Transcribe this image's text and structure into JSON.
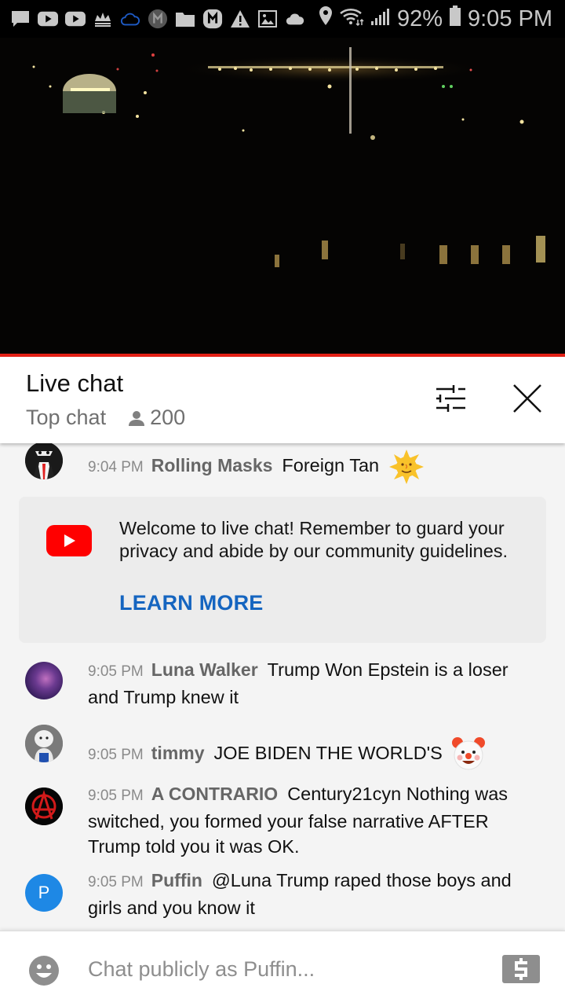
{
  "status_bar": {
    "notification_icons": [
      "message-icon",
      "youtube-icon",
      "youtube-icon",
      "crown-icon",
      "cloud-outline-icon",
      "m-app-icon",
      "folder-icon",
      "m-app-icon",
      "warning-icon",
      "image-icon",
      "cloud-icon"
    ],
    "battery": "92%",
    "time": "9:05 PM",
    "accent_cloud_color": "#1e5bc6"
  },
  "video": {
    "progress_color": "#e52117"
  },
  "header": {
    "title": "Live chat",
    "mode": "Top chat",
    "viewer_count": "200"
  },
  "messages": [
    {
      "time": "9:04 PM",
      "author": "Rolling Masks",
      "text": "Foreign Tan",
      "emoji": "🌞",
      "avatar": "mask"
    },
    {
      "time": "9:05 PM",
      "author": "Luna Walker",
      "text": "Trump Won Epstein is a loser and Trump knew it",
      "avatar": "purple"
    },
    {
      "time": "9:05 PM",
      "author": "timmy",
      "text": "JOE BIDEN THE WORLD'S",
      "emoji": "🤡",
      "avatar": "mascot"
    },
    {
      "time": "9:05 PM",
      "author": "A CONTRARIO",
      "text": "Century21cyn Nothing was switched, you formed your false narrative AFTER Trump told you it was OK.",
      "avatar": "anarchy"
    },
    {
      "time": "9:05 PM",
      "author": "Puffin",
      "text": "@Luna Trump raped those boys and girls and you know it",
      "avatar": "P",
      "avatar_color": "#1e88e5"
    }
  ],
  "welcome": {
    "text": "Welcome to live chat! Remember to guard your privacy and abide by our community guidelines.",
    "link": "LEARN MORE",
    "link_color": "#1565c0"
  },
  "input": {
    "placeholder": "Chat publicly as Puffin...",
    "value": ""
  }
}
